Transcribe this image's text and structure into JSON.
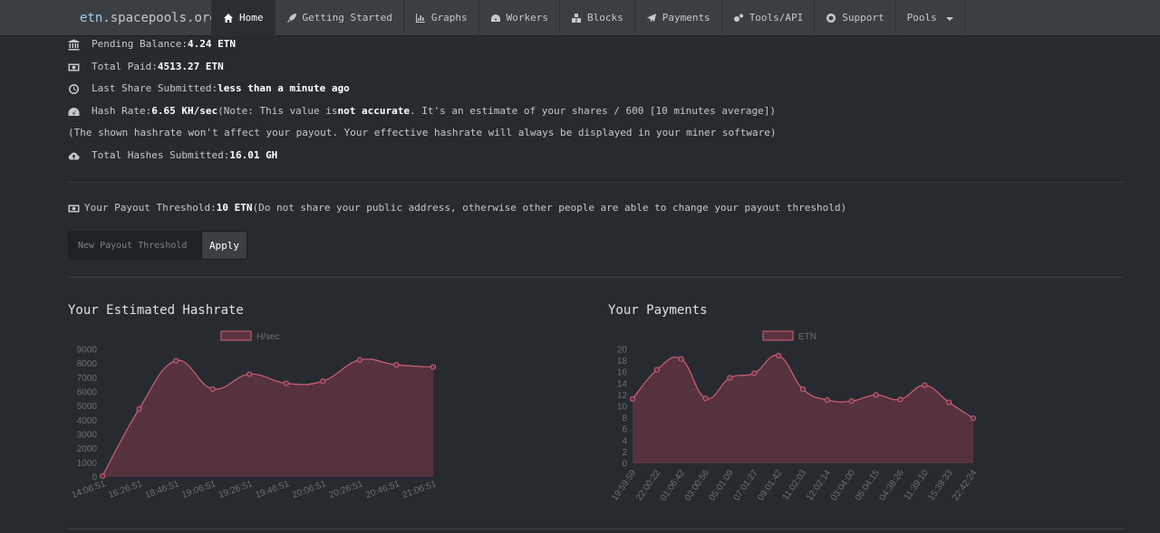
{
  "brand": {
    "part1": "etn",
    "part2": ".spacepools.org"
  },
  "nav": [
    {
      "label": "Home",
      "icon": "home-icon"
    },
    {
      "label": "Getting Started",
      "icon": "rocket-icon"
    },
    {
      "label": "Graphs",
      "icon": "bar-chart-icon"
    },
    {
      "label": "Workers",
      "icon": "dashboard-icon"
    },
    {
      "label": "Blocks",
      "icon": "cubes-icon"
    },
    {
      "label": "Payments",
      "icon": "paper-plane-icon"
    },
    {
      "label": "Tools/API",
      "icon": "cogs-icon"
    },
    {
      "label": "Support",
      "icon": "life-ring-icon"
    },
    {
      "label": "Pools",
      "icon": "caret-down-icon"
    }
  ],
  "stats": {
    "pending": {
      "label": "Pending Balance: ",
      "value": "4.24 ETN",
      "icon": "bank-icon"
    },
    "paid": {
      "label": "Total Paid: ",
      "value": "4513.27 ETN",
      "icon": "money-icon"
    },
    "last_share": {
      "label": "Last Share Submitted: ",
      "value": "less than a minute ago",
      "icon": "clock-icon"
    },
    "hashrate": {
      "label": "Hash Rate: ",
      "value": "6.65 KH/sec",
      "note_a": " (Note: This value is ",
      "note_b": "not accurate",
      "note_c": ". It's an estimate of your shares / 600 [10 minutes average])",
      "icon": "tachometer-icon"
    },
    "hashrate_note": "(The shown hashrate won't affect your payout. Your effective hashrate will always be displayed in your miner software)",
    "total_hashes": {
      "label": "Total Hashes Submitted: ",
      "value": "16.01 GH",
      "icon": "cloud-upload-icon"
    }
  },
  "threshold": {
    "label": "Your Payout Threshold: ",
    "value": "10 ETN",
    "note": " (Do not share your public address, otherwise other people are able to change your payout threshold)",
    "icon": "money-icon",
    "placeholder": "New Payout Threshold",
    "button": "Apply"
  },
  "colors": {
    "accent_fill": "#5c3340",
    "accent_line": "#d06078"
  },
  "chart_data": [
    {
      "type": "area",
      "title": "Your Estimated Hashrate",
      "legend": "H/sec",
      "x": [
        "14:06:51",
        "",
        "16:26:51",
        "",
        "18:46:51",
        "",
        "19:06:51",
        "",
        "19:26:51",
        "",
        "19:46:51",
        "",
        "20:06:51",
        "",
        "20:26:51",
        "",
        "20:46:51",
        "",
        "21:06:51"
      ],
      "xticks": [
        "14:06:51",
        "16:26:51",
        "18:46:51",
        "19:06:51",
        "19:26:51",
        "19:46:51",
        "20:06:51",
        "20:26:51",
        "20:46:51",
        "21:06:51"
      ],
      "values": [
        50,
        4800,
        8200,
        6200,
        7250,
        6600,
        6750,
        8250,
        7900,
        7750
      ],
      "ylim": [
        0,
        9000
      ],
      "yticks": [
        0,
        1000,
        2000,
        3000,
        4000,
        5000,
        6000,
        7000,
        8000,
        9000
      ]
    },
    {
      "type": "area",
      "title": "Your Payments",
      "legend": "ETN",
      "xticks": [
        "19:59:59",
        "22:00:22",
        "01:06:42",
        "03:00:56",
        "05:01:09",
        "07:01:27",
        "09:01:42",
        "11:02:03",
        "12:02:14",
        "03:04:00",
        "05:04:15",
        "04:38:26",
        "11:39:10",
        "15:39:33",
        "22:42:24"
      ],
      "values": [
        11.3,
        16.4,
        18.3,
        11.4,
        15,
        15.8,
        18.9,
        13,
        11.1,
        10.9,
        12,
        11.2,
        13.7,
        10.7,
        7.9
      ],
      "ylim": [
        0,
        20
      ],
      "yticks": [
        0,
        2,
        4,
        6,
        8,
        10,
        12,
        14,
        16,
        18,
        20
      ]
    }
  ]
}
